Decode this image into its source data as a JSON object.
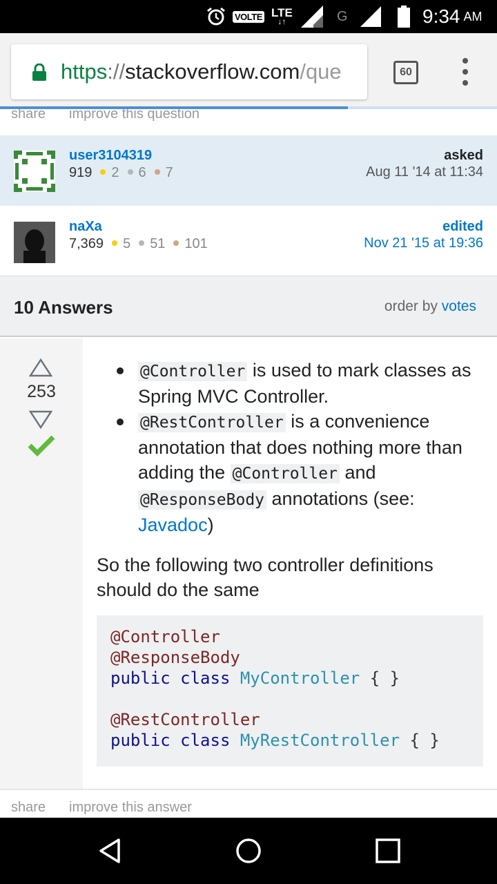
{
  "status_bar": {
    "network_badge": "VOLTE",
    "lte_label": "LTE",
    "lte_arrows": "↓↑",
    "g_label": "G",
    "time": "9:34",
    "ampm": "AM",
    "icons": [
      "alarm-icon",
      "signal-icon",
      "battery-icon"
    ]
  },
  "browser": {
    "url_scheme": "https",
    "url_sep": "://",
    "url_host": "stackoverflow.com",
    "url_path": "/que",
    "tab_count": "60",
    "load_progress": 0.7,
    "secure_color": "#0b8043"
  },
  "question_links": {
    "share": "share",
    "improve": "improve this question"
  },
  "asked_card": {
    "username": "user3104319",
    "reputation": "919",
    "gold": "2",
    "silver": "6",
    "bronze": "7",
    "action": "asked",
    "date": "Aug 11 '14 at 11:34"
  },
  "edited_card": {
    "username": "naXa",
    "reputation": "7,369",
    "gold": "5",
    "silver": "51",
    "bronze": "101",
    "action": "edited",
    "date": "Nov 21 '15 at 19:36"
  },
  "answers_header": {
    "title": "10 Answers",
    "order_prefix": "order by",
    "order_value": "votes"
  },
  "answer": {
    "votes": "253",
    "accepted": true,
    "bullet1_code": "@Controller",
    "bullet1_text": " is used to mark classes as Spring MVC Controller.",
    "bullet2_code": "@RestController",
    "bullet2_text1": " is a convenience annotation that does nothing more than adding the ",
    "bullet2_code2": "@Controller",
    "bullet2_text2": " and ",
    "bullet2_code3": "@ResponseBody",
    "bullet2_text3": " annotations (see: ",
    "bullet2_link": "Javadoc",
    "bullet2_text4": ")",
    "paragraph": "So the following two controller definitions should do the same",
    "code": {
      "l1": "@Controller",
      "l2": "@ResponseBody",
      "l3_kw": "public class",
      "l3_type": "MyController",
      "l3_rest": "{ }",
      "l5": "@RestController",
      "l6_kw": "public class",
      "l6_type": "MyRestController",
      "l6_rest": "{ }"
    },
    "share": "share",
    "improve": "improve this answer"
  },
  "nav": {
    "icons": [
      "back-icon",
      "home-icon",
      "recents-icon"
    ]
  },
  "colors": {
    "link": "#0077cc",
    "asked_bg": "#e1ecf4",
    "accepted": "#5fba3d"
  }
}
